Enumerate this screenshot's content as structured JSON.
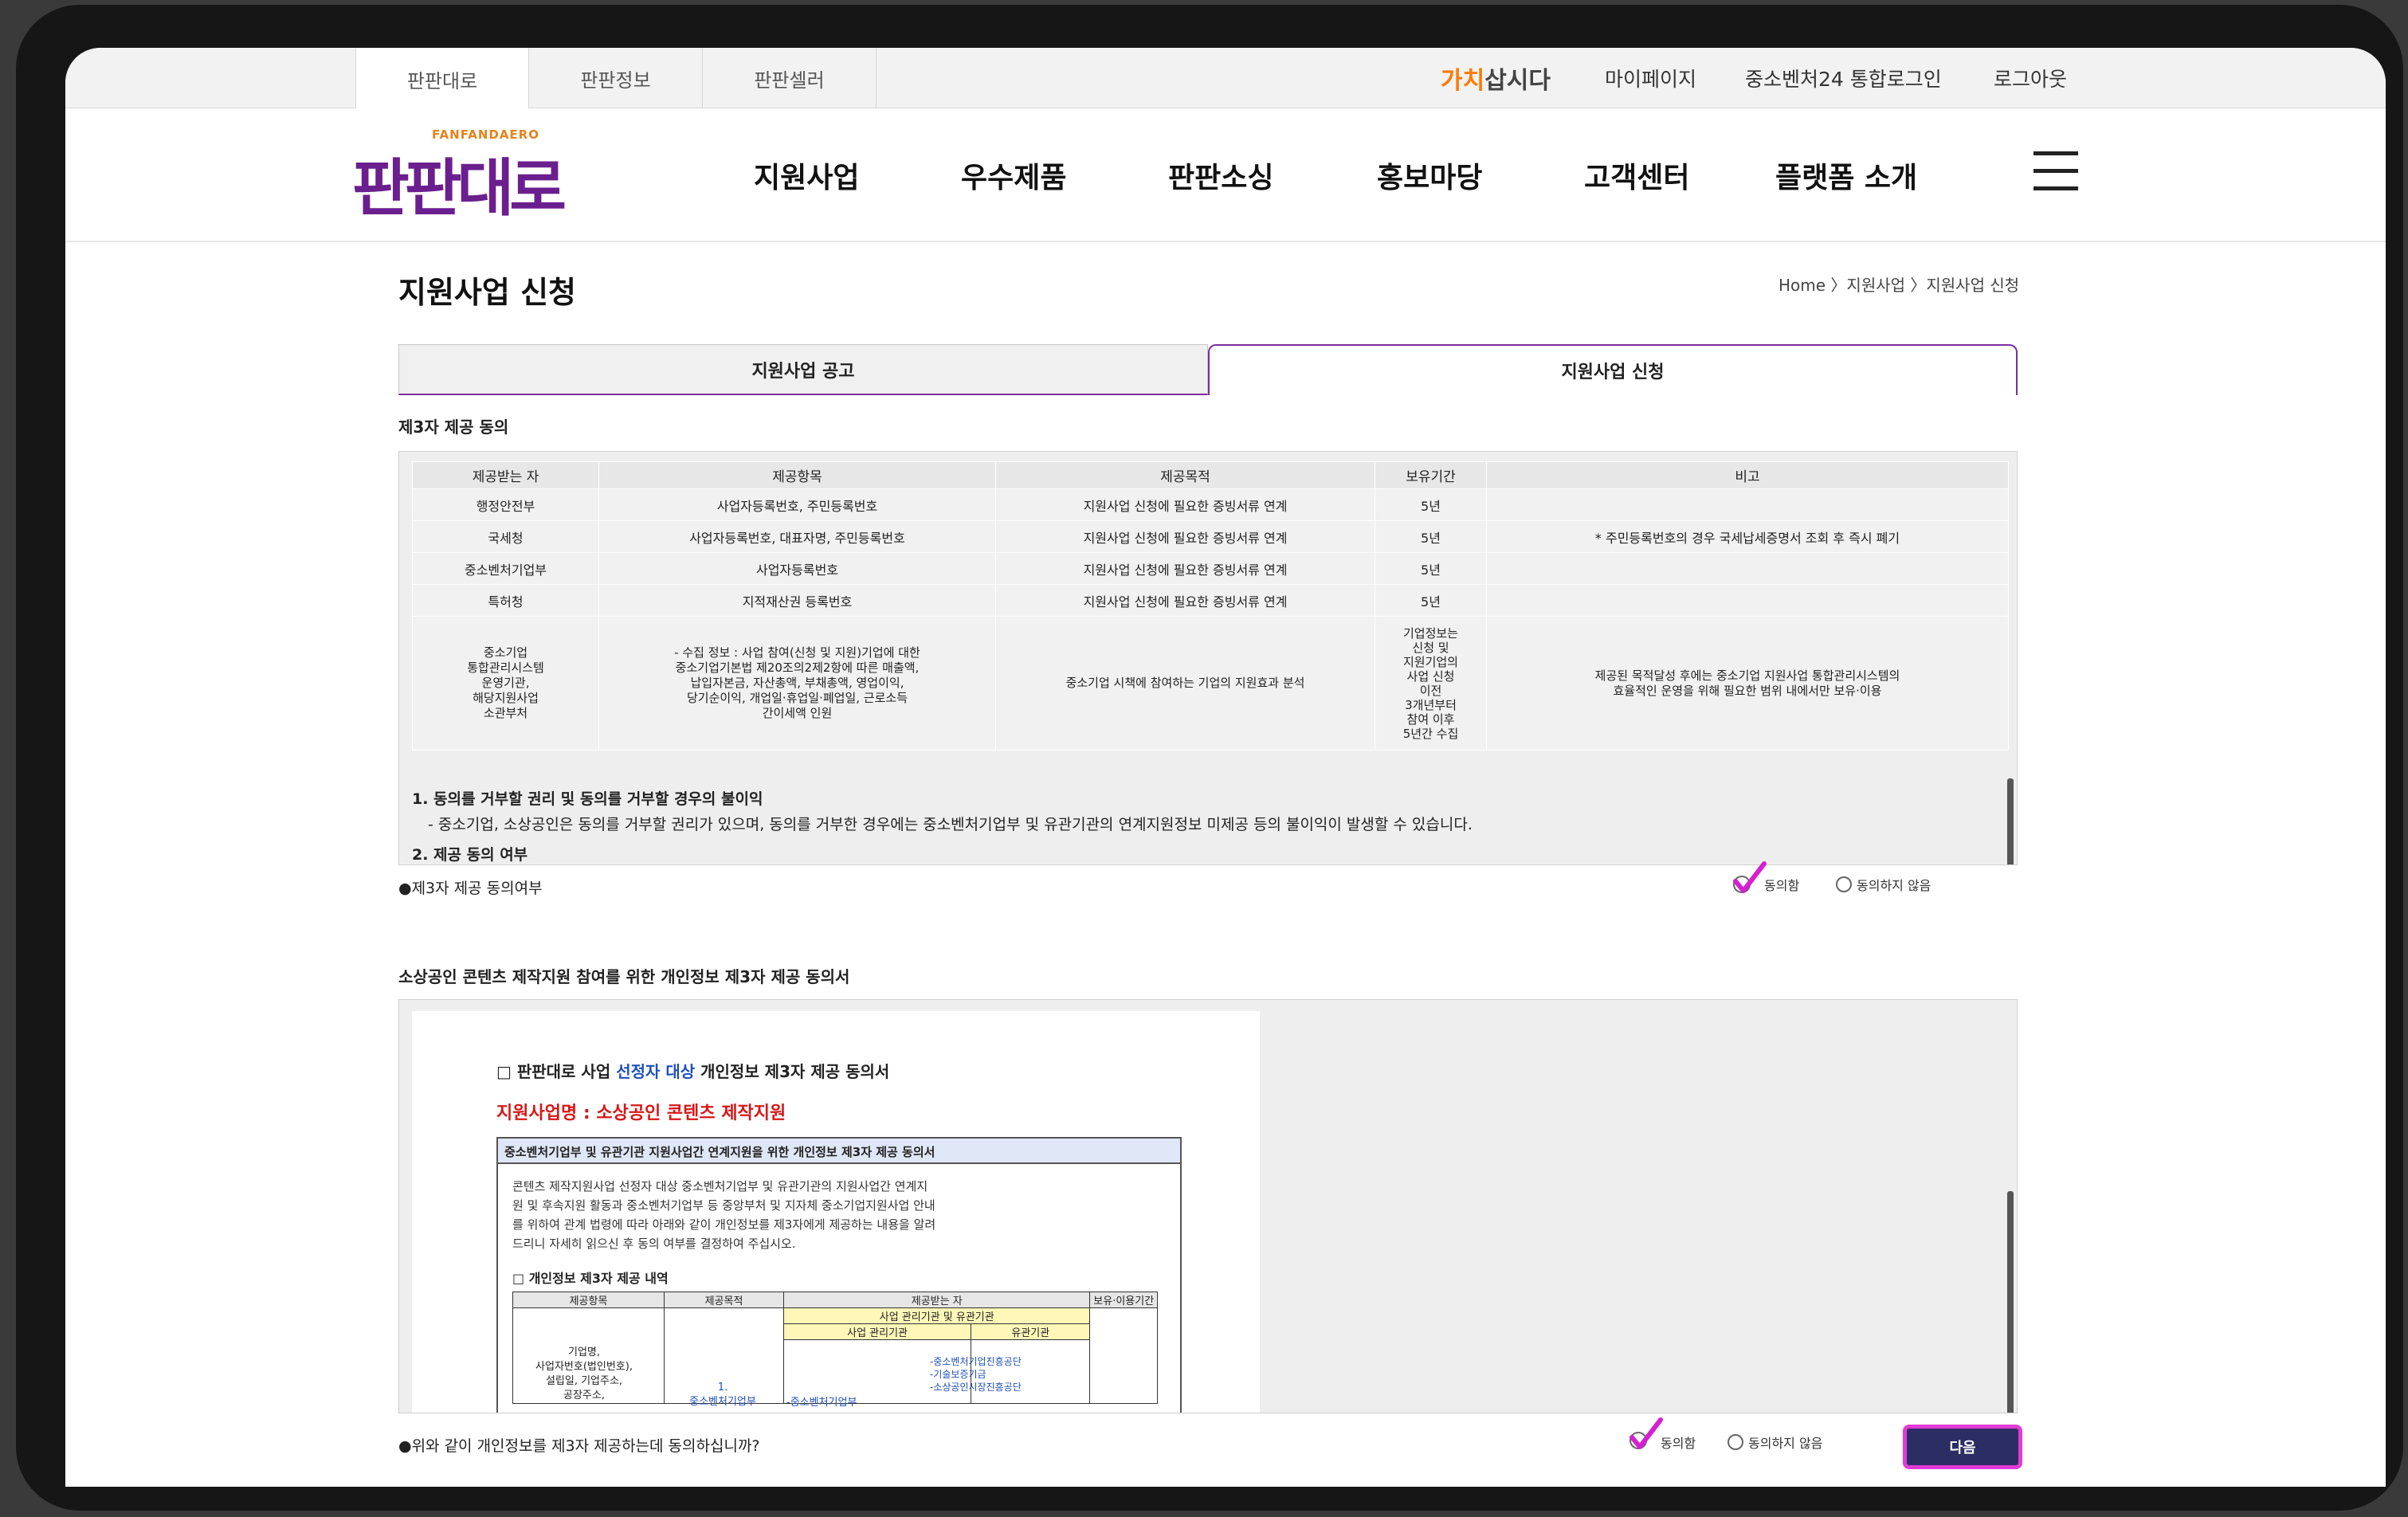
{
  "top_tabs": [
    "판판대로",
    "판판정보",
    "판판셀러"
  ],
  "util_bar": {
    "brand_orange": "가치",
    "brand_rest": "삽시다",
    "links": [
      "마이페이지",
      "중소벤처24 통합로그인",
      "로그아웃"
    ]
  },
  "logo": {
    "sub": "FANFANDAERO",
    "main": "판판대로"
  },
  "nav": [
    "지원사업",
    "우수제품",
    "판판소싱",
    "홍보마당",
    "고객센터",
    "플랫폼 소개"
  ],
  "page": {
    "title": "지원사업 신청",
    "breadcrumb": "Home 〉지원사업 〉지원사업 신청",
    "tabs": [
      "지원사업 공고",
      "지원사업 신청"
    ]
  },
  "third_party": {
    "section_title": "제3자 제공 동의",
    "headers": [
      "제공받는 자",
      "제공항목",
      "제공목적",
      "보유기간",
      "비고"
    ],
    "rows": [
      [
        "행정안전부",
        "사업자등록번호, 주민등록번호",
        "지원사업 신청에 필요한 증빙서류 연계",
        "5년",
        ""
      ],
      [
        "국세청",
        "사업자등록번호, 대표자명, 주민등록번호",
        "지원사업 신청에 필요한 증빙서류 연계",
        "5년",
        "* 주민등록번호의 경우 국세납세증명서 조회 후 즉시 폐기"
      ],
      [
        "중소벤처기업부",
        "사업자등록번호",
        "지원사업 신청에 필요한 증빙서류 연계",
        "5년",
        ""
      ],
      [
        "특허청",
        "지적재산권 등록번호",
        "지원사업 신청에 필요한 증빙서류 연계",
        "5년",
        ""
      ]
    ],
    "last_row": {
      "recipient": [
        "중소기업",
        "통합관리시스템",
        "운영기관,",
        "해당지원사업",
        "소관부처"
      ],
      "items": [
        "- 수집 정보 : 사업 참여(신청 및 지원)기업에 대한",
        "중소기업기본법 제20조의2제2항에 따른 매출액,",
        "납입자본금, 자산총액, 부채총액, 영업이익,",
        "당기순이익, 개업일·휴업일·폐업일, 근로소득",
        "간이세액 인원"
      ],
      "purpose": "중소기업 시책에 참여하는 기업의 지원효과 분석",
      "period": [
        "기업정보는",
        "신청 및",
        "지원기업의",
        "사업 신청",
        "이전",
        "3개년부터",
        "참여 이후",
        "5년간 수집"
      ],
      "note": [
        "제공된 목적달성 후에는 중소기업 지원사업 통합관리시스템의",
        "효율적인 운영을 위해 필요한 범위 내에서만 보유·이용"
      ]
    },
    "notes": {
      "n1_title": "1. 동의를 거부할 권리 및 동의를 거부할 경우의 불이익",
      "n1_body": "- 중소기업, 소상공인은 동의를 거부할 권리가 있으며, 동의를 거부한 경우에는 중소벤처기업부 및 유관기관의 연계지원정보 미제공 등의 불이익이 발생할 수 있습니다.",
      "n2_title": "2. 제공 동의 여부"
    },
    "agree_question": "●제3자 제공 동의여부",
    "agree": "동의함",
    "disagree": "동의하지 않음"
  },
  "consent_doc": {
    "section_title": "소상공인 콘텐츠 제작지원 참여를 위한 개인정보 제3자 제공 동의서",
    "doc_title_a": "□ 판판대로 사업 ",
    "doc_title_blue": "선정자 대상",
    "doc_title_b": " 개인정보 제3자 제공 동의서",
    "program": "지원사업명 : 소상공인 콘텐츠 제작지원",
    "box_title": "중소벤처기업부 및 유관기관 지원사업간 연계지원을 위한 개인정보 제3자 제공 동의서",
    "body": [
      "콘텐츠 제작지원사업 선정자 대상 중소벤처기업부 및 유관기관의 지원사업간 연계지",
      "원 및 후속지원 활동과 중소벤처기업부 등 중앙부처 및 지자체 중소기업지원사업 안내",
      "를 위하여 관계 법령에 따라 아래와 같이 개인정보를 제3자에게 제공하는 내용을 알려",
      "드리니 자세히 읽으신 후 동의 여부를 결정하여 주십시오."
    ],
    "sub_title": "□ 개인정보 제3자 제공 내역",
    "headers": [
      "제공항목",
      "제공목적",
      "제공받는 자",
      "보유·이용기간"
    ],
    "sub_headers": [
      "사업 관리기관 및 유관기관",
      "사업 관리기관",
      "유관기관"
    ],
    "cell_items": [
      "기업명,",
      "사업자번호(법인번호),",
      "설립일, 기업주소,",
      "공장주소,"
    ],
    "cell_purpose": [
      "1.",
      "중소벤처기업부"
    ],
    "cell_mgr": "-중소벤처기업부",
    "cell_rel": [
      "-중소벤처기업진흥공단",
      "-기술보증기금",
      "-소상공인시장진흥공단"
    ],
    "agree_question": "●위와 같이 개인정보를 제3자 제공하는데 동의하십니까?",
    "agree": "동의함",
    "disagree": "동의하지 않음"
  },
  "next_button": "다음",
  "colors": {
    "brand_purple": "#6b1f8e",
    "accent_orange": "#ff7a00",
    "button_navy": "#2b2d63",
    "highlight_magenta": "#e23ad6",
    "check_magenta": "#d61fd0"
  }
}
